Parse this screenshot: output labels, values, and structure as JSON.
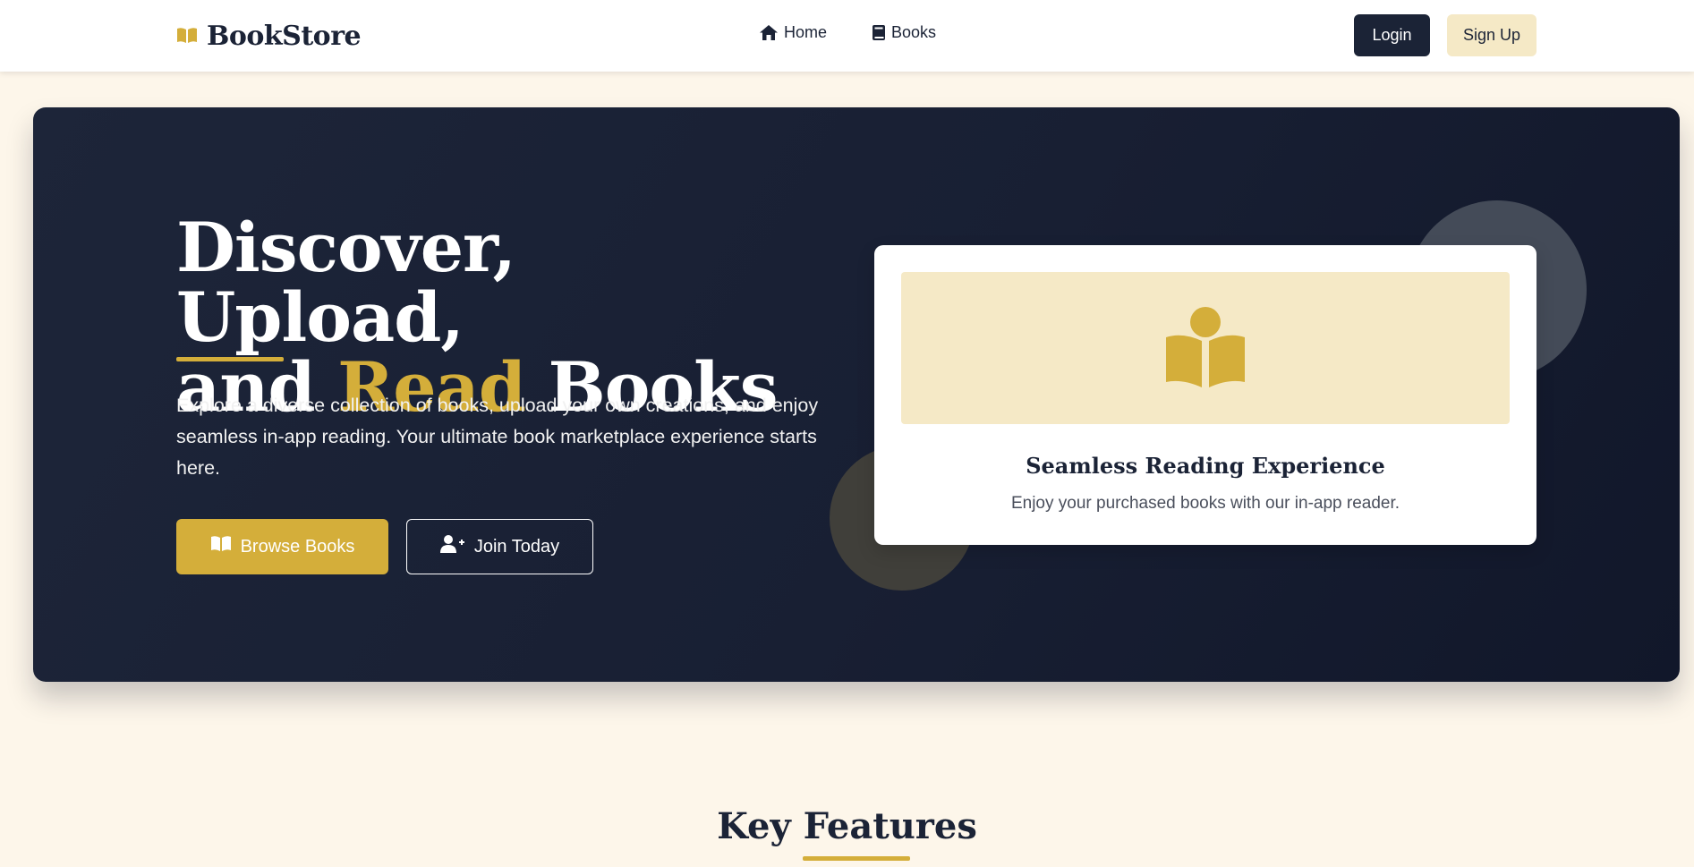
{
  "navbar": {
    "brand": "BookStore",
    "brand_icon": "open-book-icon",
    "links": [
      {
        "label": "Home",
        "icon": "home-icon"
      },
      {
        "label": "Books",
        "icon": "book-icon"
      }
    ],
    "login_label": "Login",
    "signup_label": "Sign Up"
  },
  "hero": {
    "title_line1": "Discover, Upload,",
    "title_and": "and",
    "title_accent": "Read",
    "title_books": "Books",
    "description": "Explore a diverse collection of books, upload your own creations, and enjoy seamless in-app reading. Your ultimate book marketplace experience starts here.",
    "browse_label": "Browse Books",
    "browse_icon": "open-book-icon",
    "join_label": "Join Today",
    "join_icon": "user-plus-icon"
  },
  "feature_card": {
    "icon": "book-reader-icon",
    "title": "Seamless Reading Experience",
    "description": "Enjoy your purchased books with our in-app reader."
  },
  "features_section": {
    "title": "Key Features"
  },
  "colors": {
    "primary": "#1b2336",
    "accent": "#d4ae3a",
    "accent_light": "#f5e9c6",
    "background": "#fdf6ea"
  }
}
